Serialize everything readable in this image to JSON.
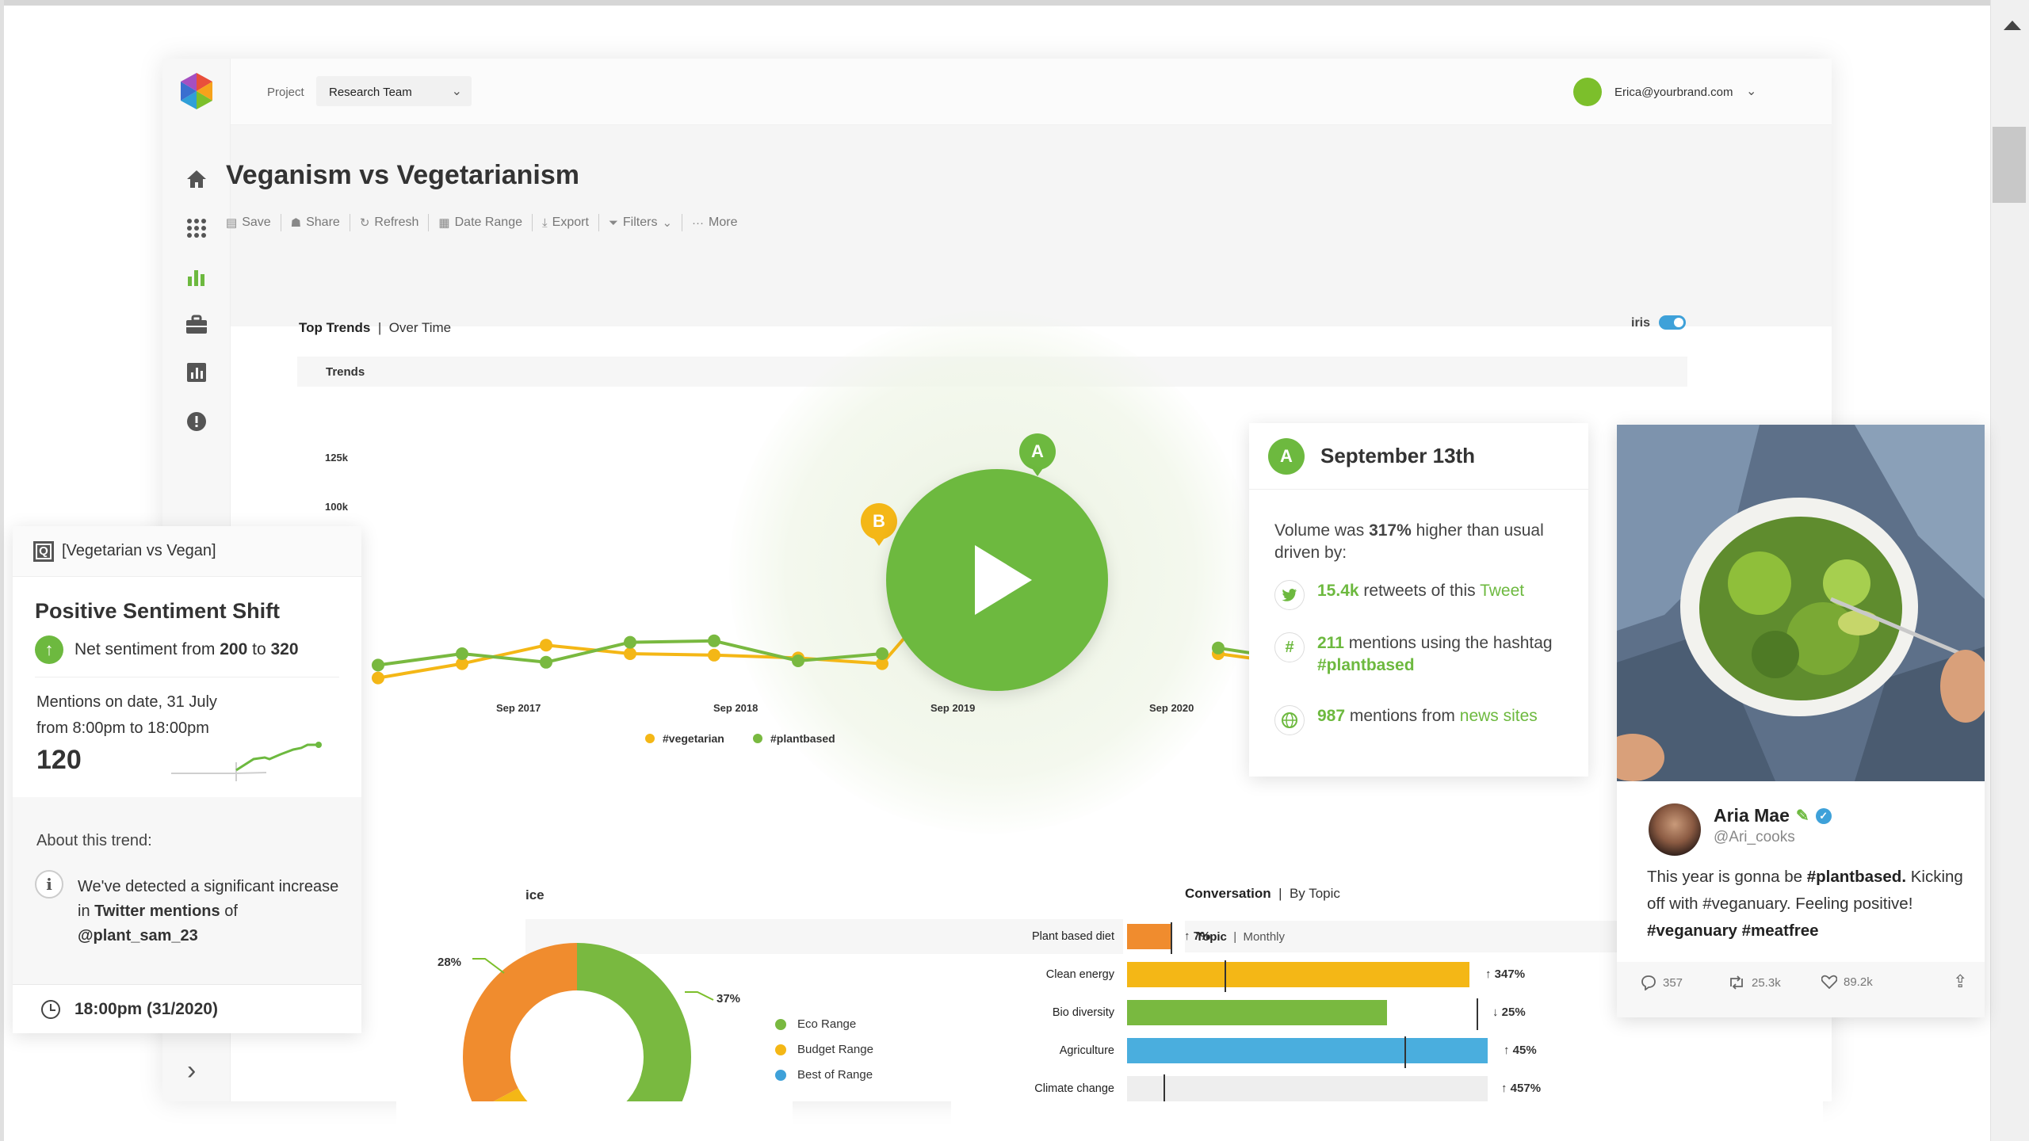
{
  "topbar": {
    "project_label": "Project",
    "project_value": "Research Team",
    "user_email": "Erica@yourbrand.com"
  },
  "page": {
    "title": "Veganism vs Vegetarianism"
  },
  "toolbar": {
    "items": [
      "Save",
      "Share",
      "Refresh",
      "Date Range",
      "Export",
      "Filters",
      "More"
    ]
  },
  "trends_section": {
    "tab_active": "Top Trends",
    "tab_inactive": "Over Time",
    "iris_label": "iris",
    "iris_enabled": true,
    "bar_title": "Trends"
  },
  "chart_data": [
    {
      "type": "line",
      "title": "",
      "x_ticks": [
        "Sep 2017",
        "Sep 2018",
        "Sep 2019",
        "Sep 2020"
      ],
      "y_ticks": [
        "125k",
        "100k"
      ],
      "series": [
        {
          "name": "#vegetarian",
          "color": "#f4b716",
          "values": [
            8,
            18,
            31,
            25,
            24,
            22,
            18,
            86,
            null,
            null,
            25,
            17
          ]
        },
        {
          "name": "#plantbased",
          "color": "#79b940",
          "values": [
            17,
            25,
            19,
            33,
            34,
            20,
            25,
            null,
            null,
            null,
            29,
            20
          ]
        }
      ],
      "annotations": [
        "A",
        "B"
      ]
    },
    {
      "type": "pie",
      "labels": [
        "Eco Range",
        "Budget Range",
        "Best of Range"
      ],
      "colors": [
        "#79b940",
        "#f4b716",
        "#3ea1d9"
      ],
      "percent_labels": [
        "28%",
        "37%"
      ]
    },
    {
      "type": "bar",
      "title": "Conversation",
      "categories": [
        "Plant based diet",
        "Clean energy",
        "Bio diversity",
        "Agriculture",
        "Climate change"
      ],
      "values": [
        7,
        347,
        25,
        45,
        457
      ],
      "change_direction": [
        "up",
        "up",
        "down",
        "up",
        "up"
      ],
      "change_labels": [
        "7%",
        "347%",
        "25%",
        "45%",
        "457%"
      ],
      "colors": [
        "#f08c2e",
        "#f4b716",
        "#79b940",
        "#4aaede",
        "#eeeeee"
      ]
    }
  ],
  "left_card": {
    "query": "[Vegetarian vs Vegan]",
    "title": "Positive Sentiment Shift",
    "net_prefix": "Net sentiment from ",
    "net_from": "200",
    "net_mid": " to ",
    "net_to": "320",
    "mentions_line1": "Mentions on date, 31 July",
    "mentions_line2": "from 8:00pm to 18:00pm",
    "mentions_value": "120",
    "about_title": "About this trend:",
    "detected_prefix": "We've detected a significant increase in ",
    "detected_bold": "Twitter mentions",
    "detected_mid": " of ",
    "detected_handle": "@plant_sam_23",
    "time": "18:00pm (31/2020)"
  },
  "sep_card": {
    "badge": "A",
    "title": "September 13th",
    "volume_prefix": "Volume was ",
    "volume_pct": "317%",
    "volume_suffix": " higher than usual driven by:",
    "row1_num": "15.4k",
    "row1_text": " retweets of this ",
    "row1_link": "Tweet",
    "row2_num": "211",
    "row2_text": " mentions using the hashtag ",
    "row2_link": "#plantbased",
    "row3_num": "987",
    "row3_text": " mentions from ",
    "row3_link": "news sites"
  },
  "tweet": {
    "name": "Aria Mae",
    "handle": "@Ari_cooks",
    "text_1": "This year is gonna be ",
    "text_2": "#plantbased.",
    "text_3": " Kicking off with #veganuary. Feeling positive! ",
    "text_4": "#veganuary #meatfree",
    "replies": "357",
    "retweets": "25.3k",
    "likes": "89.2k"
  },
  "conversation": {
    "tab_active": "Conversation",
    "tab_inactive": "By Topic",
    "sub_active": "Topic",
    "sub_inactive": "Monthly"
  },
  "bottom_left": {
    "tab_partial": "ice"
  },
  "colors": {
    "green": "#6db93f",
    "yellow": "#f4b716",
    "orange": "#f08c2e",
    "blue": "#3ea1d9"
  }
}
